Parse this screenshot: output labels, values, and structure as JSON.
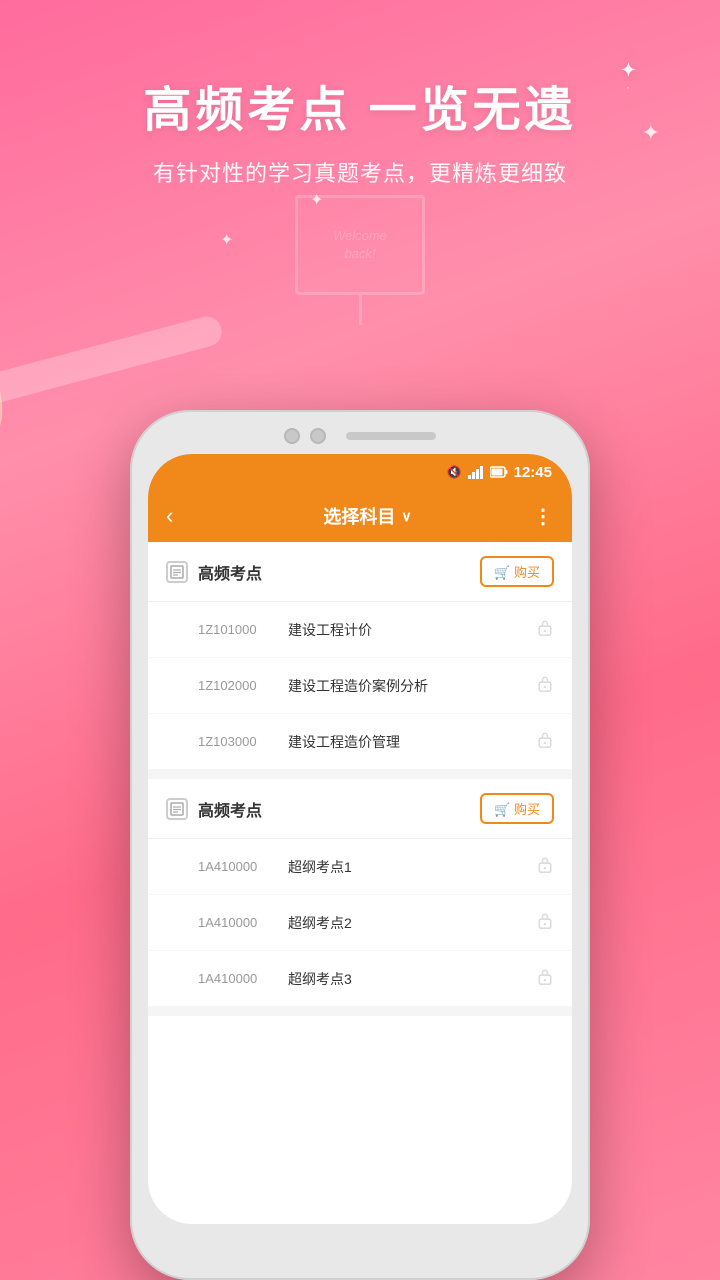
{
  "app": {
    "background_gradient_start": "#ff6b9d",
    "background_gradient_end": "#ff85a1"
  },
  "header": {
    "main_title": "高频考点 一览无遗",
    "subtitle": "有针对性的学习真题考点，更精炼更细致"
  },
  "illustration": {
    "welcome_text_line1": "Welcome",
    "welcome_text_line2": "back!"
  },
  "status_bar": {
    "time": "12:45",
    "signal_icon": "📶",
    "battery_icon": "🔋"
  },
  "nav_bar": {
    "back_icon": "‹",
    "title": "选择科目",
    "chevron_icon": "∨",
    "more_icon": "⋮"
  },
  "sections": [
    {
      "id": "section1",
      "title": "高频考点",
      "buy_label": "🛒 购买",
      "items": [
        {
          "code": "1Z101000",
          "name": "建设工程计价"
        },
        {
          "code": "1Z102000",
          "name": "建设工程造价案例分析"
        },
        {
          "code": "1Z103000",
          "name": "建设工程造价管理"
        }
      ]
    },
    {
      "id": "section2",
      "title": "高频考点",
      "buy_label": "🛒 购买",
      "items": [
        {
          "code": "1A410000",
          "name": "超纲考点1"
        },
        {
          "code": "1A410000",
          "name": "超纲考点2"
        },
        {
          "code": "1A410000",
          "name": "超纲考点3"
        }
      ]
    }
  ],
  "colors": {
    "orange": "#f0891a",
    "pink_bg": "#ff6b9d",
    "text_dark": "#333333",
    "text_gray": "#999999"
  }
}
